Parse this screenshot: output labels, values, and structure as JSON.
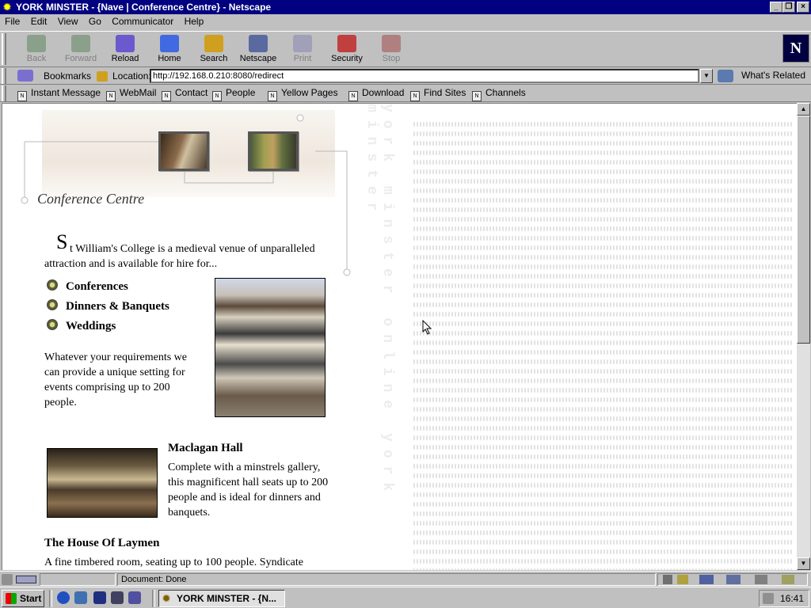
{
  "window": {
    "title": "YORK MINSTER - {Nave | Conference Centre} - Netscape"
  },
  "menu": [
    "File",
    "Edit",
    "View",
    "Go",
    "Communicator",
    "Help"
  ],
  "toolbar": [
    {
      "label": "Back",
      "enabled": false,
      "icon": "back-arrow-icon",
      "color": "#8aa08a"
    },
    {
      "label": "Forward",
      "enabled": false,
      "icon": "forward-arrow-icon",
      "color": "#8aa08a"
    },
    {
      "label": "Reload",
      "enabled": true,
      "icon": "reload-icon",
      "color": "#6a5acd"
    },
    {
      "label": "Home",
      "enabled": true,
      "icon": "home-icon",
      "color": "#4169e1"
    },
    {
      "label": "Search",
      "enabled": true,
      "icon": "search-icon",
      "color": "#cfa020"
    },
    {
      "label": "Netscape",
      "enabled": true,
      "icon": "netscape-icon",
      "color": "#5a6aa0"
    },
    {
      "label": "Print",
      "enabled": false,
      "icon": "print-icon",
      "color": "#a0a0b8"
    },
    {
      "label": "Security",
      "enabled": true,
      "icon": "lock-icon",
      "color": "#c04040"
    },
    {
      "label": "Stop",
      "enabled": false,
      "icon": "stop-icon",
      "color": "#b08080"
    }
  ],
  "location": {
    "bookmarks": "Bookmarks",
    "label": "Location:",
    "url": "http://192.168.0.210:8080/redirect",
    "related": "What's Related"
  },
  "personal_toolbar": [
    "Instant Message",
    "WebMail",
    "Contact",
    "People",
    "Yellow Pages",
    "Download",
    "Find Sites",
    "Channels"
  ],
  "page": {
    "vertical_text": "york minster online york minster",
    "heading": "Conference Centre",
    "dropcap": "S",
    "intro": "t William's College is a medieval venue of unparalleled attraction and is available for hire for...",
    "bullets": [
      "Conferences",
      "Dinners & Banquets",
      "Weddings"
    ],
    "requirements": "Whatever your requirements we can provide a unique setting for events comprising up to 200 people.",
    "hall_title": "Maclagan Hall",
    "hall_text": "Complete with a minstrels gallery, this magnificent hall seats up to 200 people and is ideal for dinners and banquets.",
    "laymen_title": "The House Of Laymen",
    "laymen_text": "A fine timbered room, seating up to 100 people. Syndicate"
  },
  "status": {
    "text": "Document: Done"
  },
  "taskbar": {
    "start": "Start",
    "task": "YORK MINSTER - {N...",
    "clock": "16:41"
  }
}
